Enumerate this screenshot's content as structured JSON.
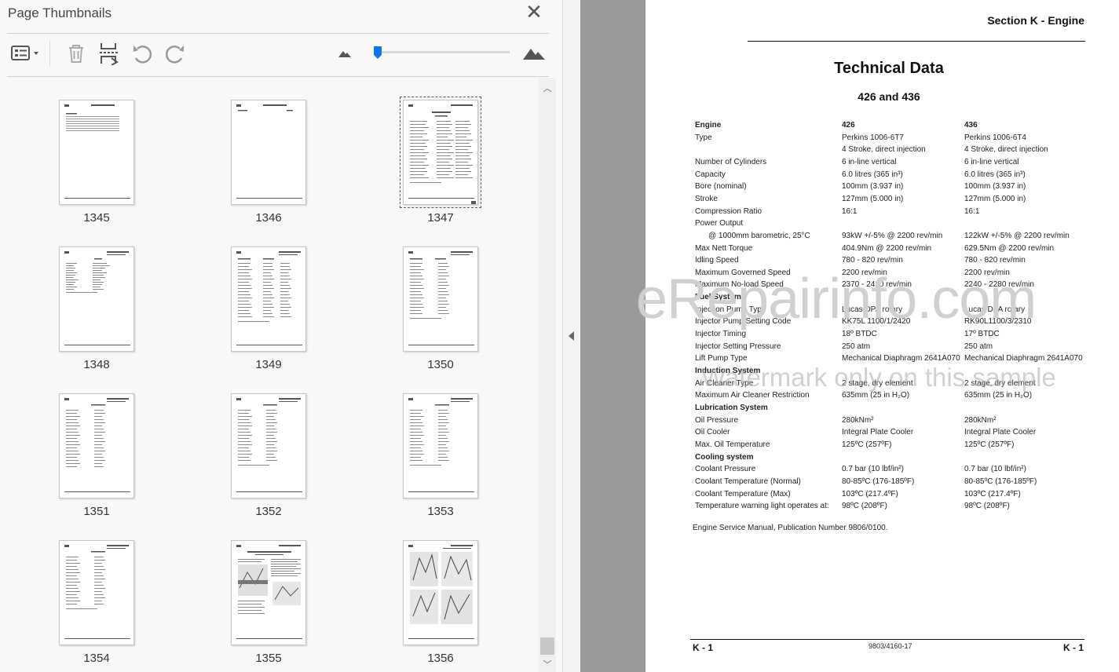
{
  "panel": {
    "title": "Page Thumbnails",
    "close_glyph": "✕",
    "toolbar": {
      "options_icon": "thumbnail-options-icon",
      "delete_icon": "trash-icon",
      "insert_icon": "insert-page-icon",
      "rotate_left_icon": "rotate-counterclockwise-icon",
      "rotate_right_icon": "rotate-clockwise-icon",
      "zoom_out_icon": "small-mountain-icon",
      "zoom_in_icon": "large-mountain-icon",
      "zoom_level": 0.03
    },
    "thumbnails": [
      {
        "page": "1345",
        "selected": false
      },
      {
        "page": "1346",
        "selected": false
      },
      {
        "page": "1347",
        "selected": true
      },
      {
        "page": "1348",
        "selected": false
      },
      {
        "page": "1349",
        "selected": false
      },
      {
        "page": "1350",
        "selected": false
      },
      {
        "page": "1351",
        "selected": false
      },
      {
        "page": "1352",
        "selected": false
      },
      {
        "page": "1353",
        "selected": false
      },
      {
        "page": "1354",
        "selected": false
      },
      {
        "page": "1355",
        "selected": false
      },
      {
        "page": "1356",
        "selected": false
      }
    ],
    "scroll_up_glyph": "︿",
    "scroll_down_glyph": "﹀"
  },
  "document": {
    "section_header": "Section K - Engine",
    "title": "Technical Data",
    "subtitle": "426 and 436",
    "rows": [
      {
        "label": "Engine",
        "a": "426",
        "b": "436",
        "bold": true
      },
      {
        "label": "Type",
        "a": "Perkins 1006-6T7",
        "b": "Perkins 1006-6T4"
      },
      {
        "label": "",
        "a": "4 Stroke, direct injection",
        "b": "4 Stroke, direct injection"
      },
      {
        "label": "Number of Cylinders",
        "a": "6 in-line vertical",
        "b": "6 in-line vertical"
      },
      {
        "label": "Capacity",
        "a": "6.0 litres (365 in³)",
        "b": "6.0 litres (365 in³)"
      },
      {
        "label": "Bore (nominal)",
        "a": "100mm (3.937 in)",
        "b": "100mm (3.937 in)"
      },
      {
        "label": "Stroke",
        "a": "127mm (5.000 in)",
        "b": "127mm (5.000 in)"
      },
      {
        "label": "Compression Ratio",
        "a": "16:1",
        "b": "16:1"
      },
      {
        "label": "Power Output",
        "a": "",
        "b": ""
      },
      {
        "label": "@ 1000mm barometric, 25°C",
        "a": "93kW +/-5% @ 2200 rev/min",
        "b": "122kW +/-5% @ 2200 rev/min",
        "indent": true
      },
      {
        "label": "Max Nett Torque",
        "a": "404.9Nm @ 2200 rev/min",
        "b": "629.5Nm @ 2200 rev/min"
      },
      {
        "label": "Idling Speed",
        "a": "780 - 820 rev/min",
        "b": "780 - 820 rev/min"
      },
      {
        "label": "Maximum Governed Speed",
        "a": "2200 rev/min",
        "b": "2200 rev/min"
      },
      {
        "label": "Maximum No-load Speed",
        "a": "2370 - 2410 rev/min",
        "b": "2240 - 2280 rev/min"
      },
      {
        "label": "Fuel System",
        "a": "",
        "b": "",
        "bold": true
      },
      {
        "label": "Injection Pump Type",
        "a": "Lucas DPA rotary",
        "b": "Lucas DPA rotary"
      },
      {
        "label": "Injector Pump Setting Code",
        "a": "KK75L 1100/1/2420",
        "b": "RK90L1100/3/2310"
      },
      {
        "label": "Injector Timing",
        "a": "18º BTDC",
        "b": "17º BTDC"
      },
      {
        "label": "Injector Setting Pressure",
        "a": "250 atm",
        "b": "250 atm"
      },
      {
        "label": "Lift Pump Type",
        "a": "Mechanical Diaphragm 2641A070",
        "b": "Mechanical Diaphragm 2641A070"
      },
      {
        "label": "Induction System",
        "a": "",
        "b": "",
        "bold": true
      },
      {
        "label": "Air Cleaner Type",
        "a": "2 stage, dry element",
        "b": "2 stage, dry element"
      },
      {
        "label": "Maximum Air Cleaner Restriction",
        "a": "635mm (25 in H₂O)",
        "b": "635mm (25 in H₂O)"
      },
      {
        "label": "Lubrication System",
        "a": "",
        "b": "",
        "bold": true
      },
      {
        "label": "Oil Pressure",
        "a": "280kNm²",
        "b": "280kNm²"
      },
      {
        "label": "Oil Cooler",
        "a": "Integral Plate Cooler",
        "b": "Integral Plate Cooler"
      },
      {
        "label": "Max. Oil Temperature",
        "a": "125ºC (257ºF)",
        "b": "125ºC (257ºF)"
      },
      {
        "label": "Cooling system",
        "a": "",
        "b": "",
        "bold": true
      },
      {
        "label": "Coolant Pressure",
        "a": "0.7 bar (10 lbf/in²)",
        "b": "0.7 bar (10 lbf/in²)"
      },
      {
        "label": "Coolant Temperature (Normal)",
        "a": "80-85ºC (176-185ºF)",
        "b": "80-85ºC (176-185ºF)"
      },
      {
        "label": "Coolant Temperature (Max)",
        "a": "103ºC (217.4ºF)",
        "b": "103ºC (217.4ºF)"
      },
      {
        "label": "Temperature warning light operates at:",
        "a": "98ºC (208ºF)",
        "b": "98ºC (208ºF)"
      }
    ],
    "note": "Engine Service Manual, Publication Number 9806/0100.",
    "footer_left": "K - 1",
    "footer_center": "9803/4160-17",
    "footer_right": "K - 1"
  },
  "watermark": {
    "line1": "eRepairinfo.com",
    "line2": "Watermark only on this sample"
  }
}
